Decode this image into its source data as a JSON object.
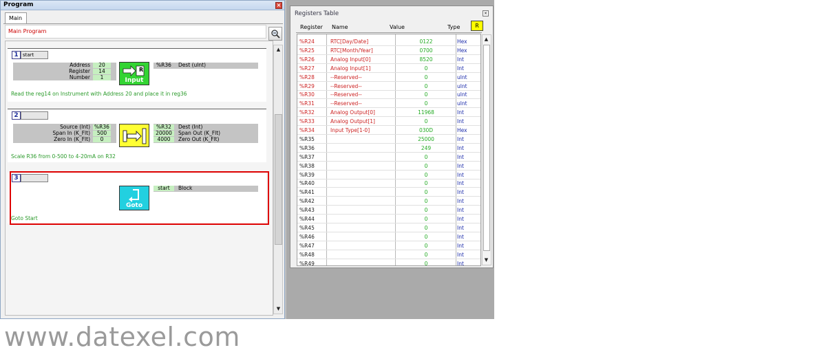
{
  "program": {
    "title": "Program",
    "close_glyph": "×",
    "tab": "Main",
    "main_title": "Main Program",
    "blocks": [
      {
        "number": "1",
        "label": "start",
        "params": [
          "Address",
          "Register",
          "Number"
        ],
        "values": [
          "20",
          "14",
          "1"
        ],
        "icon": "input-icon",
        "icon_label": "Input",
        "icon_letter": "R",
        "out_reg": "%R36",
        "out_desc": "Dest (ulnt)",
        "comment": "Read the reg14 on Instrument with Address 20 and place it in reg36"
      },
      {
        "number": "2",
        "label": "",
        "params": [
          "Source (Int)",
          "Span In (K_Flt)",
          "Zero In (K_Flt)"
        ],
        "values": [
          "%R36",
          "500",
          "0"
        ],
        "icon": "scale-icon",
        "out_vals": [
          "%R32",
          "20000",
          "4000"
        ],
        "out_descs": [
          "Dest (Int)",
          "Span Out (K_Flt)",
          "Zero Out (K_Flt)"
        ],
        "comment": "Scale R36 from 0-500 to 4-20mA on R32"
      },
      {
        "number": "3",
        "label": "",
        "icon": "goto-icon",
        "icon_label": "Goto",
        "target": "start",
        "target_desc": "Block",
        "comment": "Goto Start"
      }
    ]
  },
  "registers": {
    "title": "Registers Table",
    "close_glyph": "×",
    "headers": {
      "register": "Register",
      "name": "Name",
      "value": "Value",
      "type": "Type"
    },
    "r_button": "R",
    "colors": {
      "red_reg": "#cc2222",
      "dark_reg": "#222222",
      "value": "#22aa22",
      "type": "#1a2aaa"
    },
    "rows": [
      {
        "reg": "%R24",
        "name": "RTC[Day/Date]",
        "value": "0122",
        "type": "Hex",
        "hl": true
      },
      {
        "reg": "%R25",
        "name": "RTC[Month/Year]",
        "value": "0700",
        "type": "Hex",
        "hl": true
      },
      {
        "reg": "%R26",
        "name": "Analog Input[0]",
        "value": "8520",
        "type": "Int",
        "hl": true
      },
      {
        "reg": "%R27",
        "name": "Analog Input[1]",
        "value": "0",
        "type": "Int",
        "hl": true
      },
      {
        "reg": "%R28",
        "name": "--Reserved--",
        "value": "0",
        "type": "ulnt",
        "hl": true
      },
      {
        "reg": "%R29",
        "name": "--Reserved--",
        "value": "0",
        "type": "ulnt",
        "hl": true
      },
      {
        "reg": "%R30",
        "name": "--Reserved--",
        "value": "0",
        "type": "ulnt",
        "hl": true
      },
      {
        "reg": "%R31",
        "name": "--Reserved--",
        "value": "0",
        "type": "ulnt",
        "hl": true
      },
      {
        "reg": "%R32",
        "name": "Analog Output[0]",
        "value": "11968",
        "type": "Int",
        "hl": true
      },
      {
        "reg": "%R33",
        "name": "Analog Output[1]",
        "value": "0",
        "type": "Int",
        "hl": true
      },
      {
        "reg": "%R34",
        "name": "Input Type[1-0]",
        "value": "030D",
        "type": "Hex",
        "hl": true
      },
      {
        "reg": "%R35",
        "name": "",
        "value": "25000",
        "type": "Int",
        "hl": false
      },
      {
        "reg": "%R36",
        "name": "",
        "value": "249",
        "type": "Int",
        "hl": false
      },
      {
        "reg": "%R37",
        "name": "",
        "value": "0",
        "type": "Int",
        "hl": false
      },
      {
        "reg": "%R38",
        "name": "",
        "value": "0",
        "type": "Int",
        "hl": false
      },
      {
        "reg": "%R39",
        "name": "",
        "value": "0",
        "type": "Int",
        "hl": false
      },
      {
        "reg": "%R40",
        "name": "",
        "value": "0",
        "type": "Int",
        "hl": false
      },
      {
        "reg": "%R41",
        "name": "",
        "value": "0",
        "type": "Int",
        "hl": false
      },
      {
        "reg": "%R42",
        "name": "",
        "value": "0",
        "type": "Int",
        "hl": false
      },
      {
        "reg": "%R43",
        "name": "",
        "value": "0",
        "type": "Int",
        "hl": false
      },
      {
        "reg": "%R44",
        "name": "",
        "value": "0",
        "type": "Int",
        "hl": false
      },
      {
        "reg": "%R45",
        "name": "",
        "value": "0",
        "type": "Int",
        "hl": false
      },
      {
        "reg": "%R46",
        "name": "",
        "value": "0",
        "type": "Int",
        "hl": false
      },
      {
        "reg": "%R47",
        "name": "",
        "value": "0",
        "type": "Int",
        "hl": false
      },
      {
        "reg": "%R48",
        "name": "",
        "value": "0",
        "type": "Int",
        "hl": false
      },
      {
        "reg": "%R49",
        "name": "",
        "value": "0",
        "type": "Int",
        "hl": false
      }
    ]
  },
  "footer": {
    "url": "www.datexel.com"
  }
}
